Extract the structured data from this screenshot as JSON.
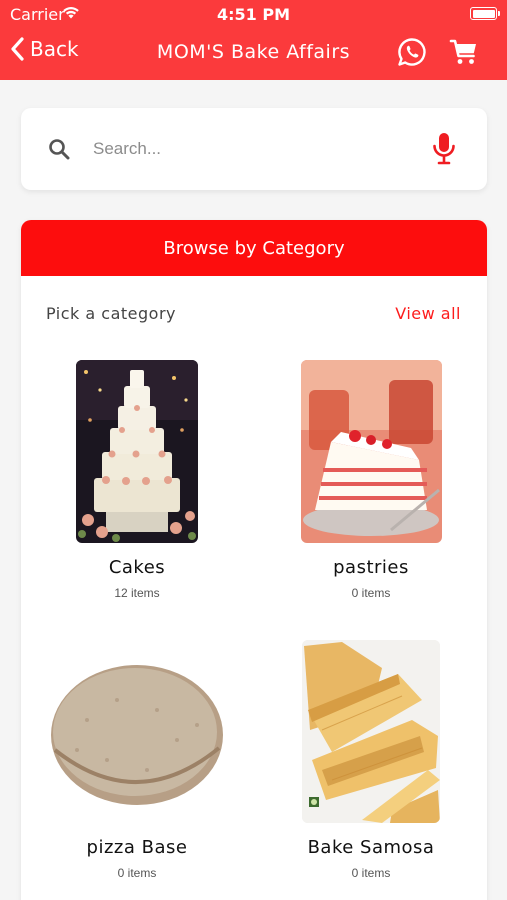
{
  "status_bar": {
    "carrier": "Carrier",
    "time": "4:51 PM"
  },
  "nav": {
    "back_label": "Back",
    "title": "MOM'S Bake Affairs"
  },
  "search": {
    "placeholder": "Search..."
  },
  "browse": {
    "header": "Browse by Category",
    "pick_label": "Pick a category",
    "view_all_label": "View all",
    "categories": [
      {
        "name": "Cakes",
        "count": "12 items"
      },
      {
        "name": "pastries",
        "count": "0 items"
      },
      {
        "name": "pizza Base",
        "count": "0 items"
      },
      {
        "name": "Bake Samosa",
        "count": "0 items"
      }
    ]
  },
  "colors": {
    "brand": "#fb3a3c",
    "accent": "#fd0d0d",
    "link": "#fd1c1c"
  }
}
